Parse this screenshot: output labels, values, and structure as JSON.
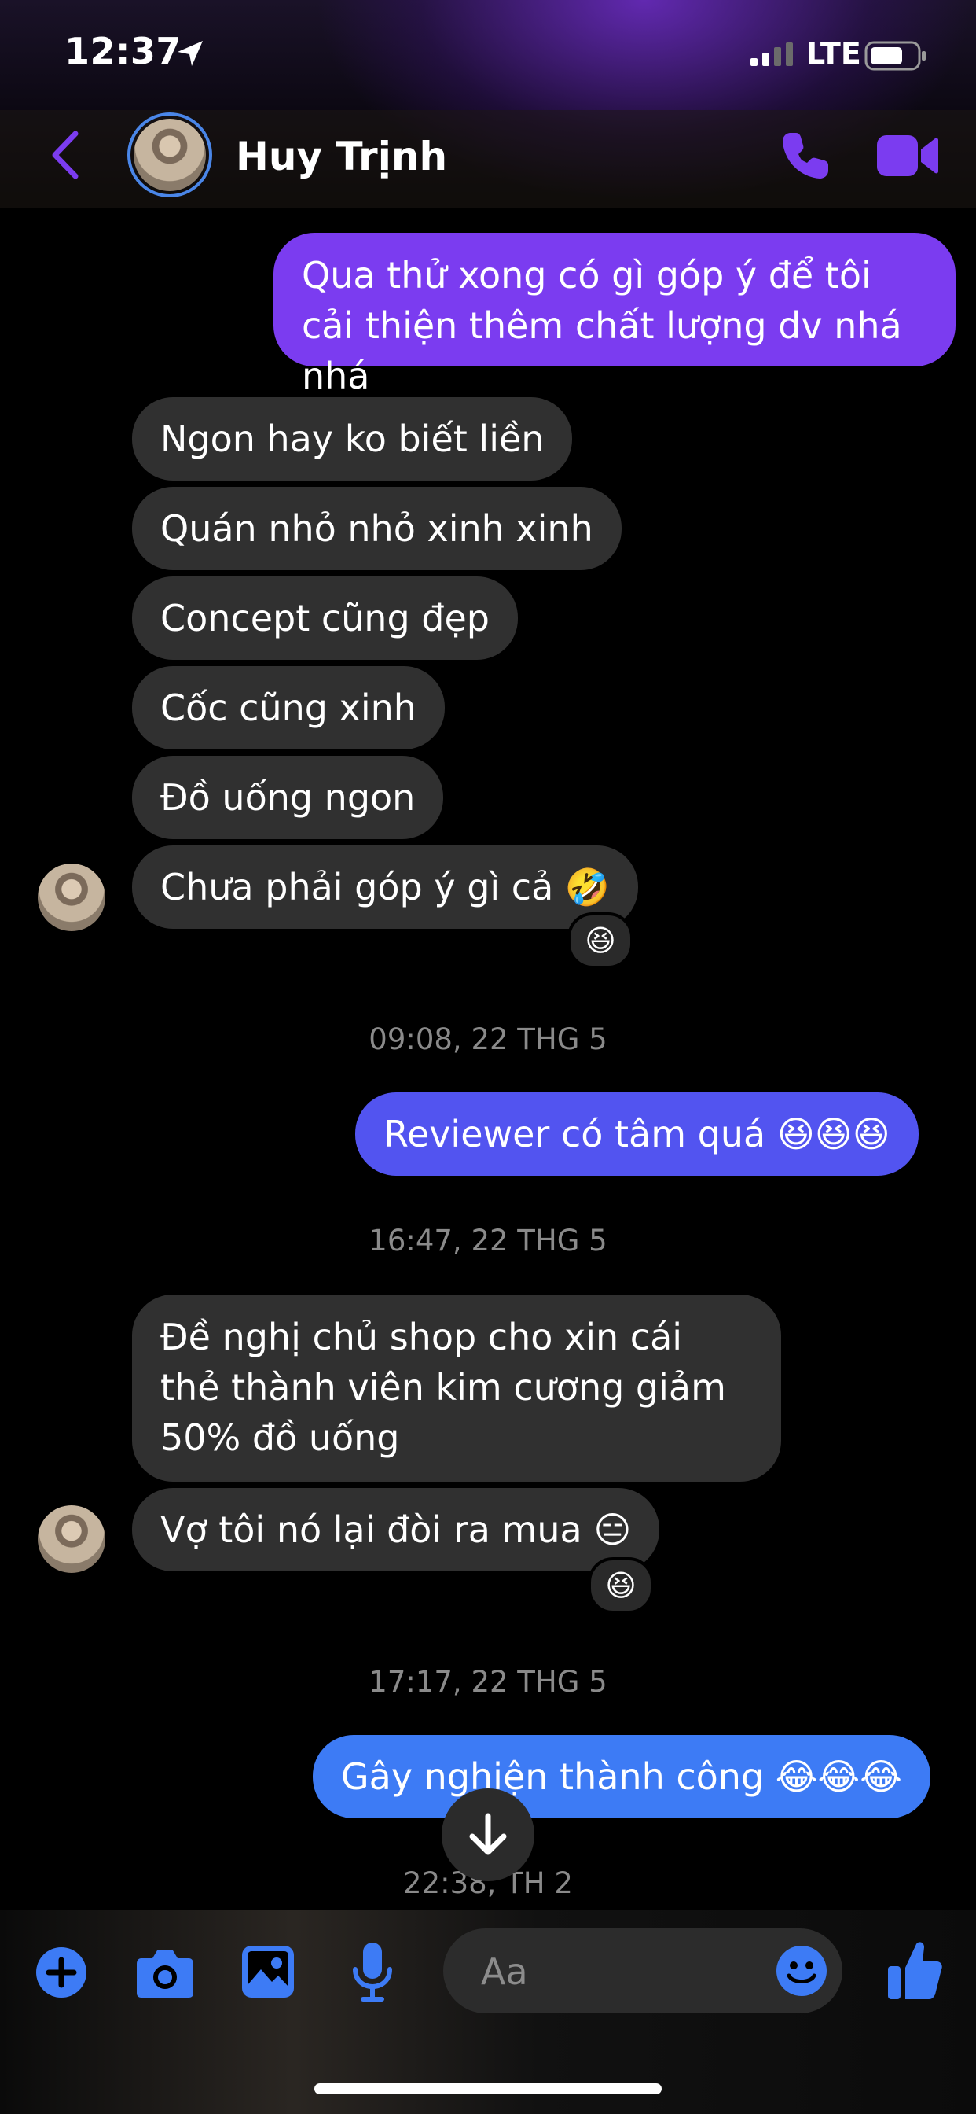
{
  "status_bar": {
    "time": "12:37",
    "network": "LTE"
  },
  "header": {
    "contact_name": "Huy Trịnh"
  },
  "colors": {
    "accent_purple": "#7b3cf0",
    "accent_blue": "#3d7bf5",
    "incoming_bubble": "#303030"
  },
  "messages": {
    "m1": "Qua thử xong có gì góp ý để tôi cải thiện thêm chất lượng dv nhá nhá",
    "m2": "Ngon hay ko biết liền",
    "m3": "Quán nhỏ nhỏ xinh xinh",
    "m4": "Concept cũng đẹp",
    "m5": "Cốc cũng xinh",
    "m6": "Đồ uống ngon",
    "m7": "Chưa phải góp ý gì cả 🤣",
    "m7_reaction": "😆",
    "ts1": "09:08, 22 THG 5",
    "m8": "Reviewer có tâm quá 😆😆😆",
    "ts2": "16:47, 22 THG 5",
    "m9": "Đề nghị chủ shop cho xin cái thẻ thành viên kim cương giảm 50% đồ uống",
    "m10": "Vợ tôi nó lại đòi ra mua 😑",
    "m10_reaction": "😆",
    "ts3": "17:17, 22 THG 5",
    "m11": "Gây nghiện thành công 😂😂😂",
    "ts4": "22:38, TH 2"
  },
  "composer": {
    "placeholder": "Aa"
  },
  "icons": [
    "location-arrow-icon",
    "signal-icon",
    "battery-icon",
    "back-chevron-icon",
    "phone-icon",
    "video-camera-icon",
    "arrow-down-icon",
    "plus-icon",
    "camera-icon",
    "image-icon",
    "microphone-icon",
    "emoji-icon",
    "thumbs-up-icon"
  ]
}
